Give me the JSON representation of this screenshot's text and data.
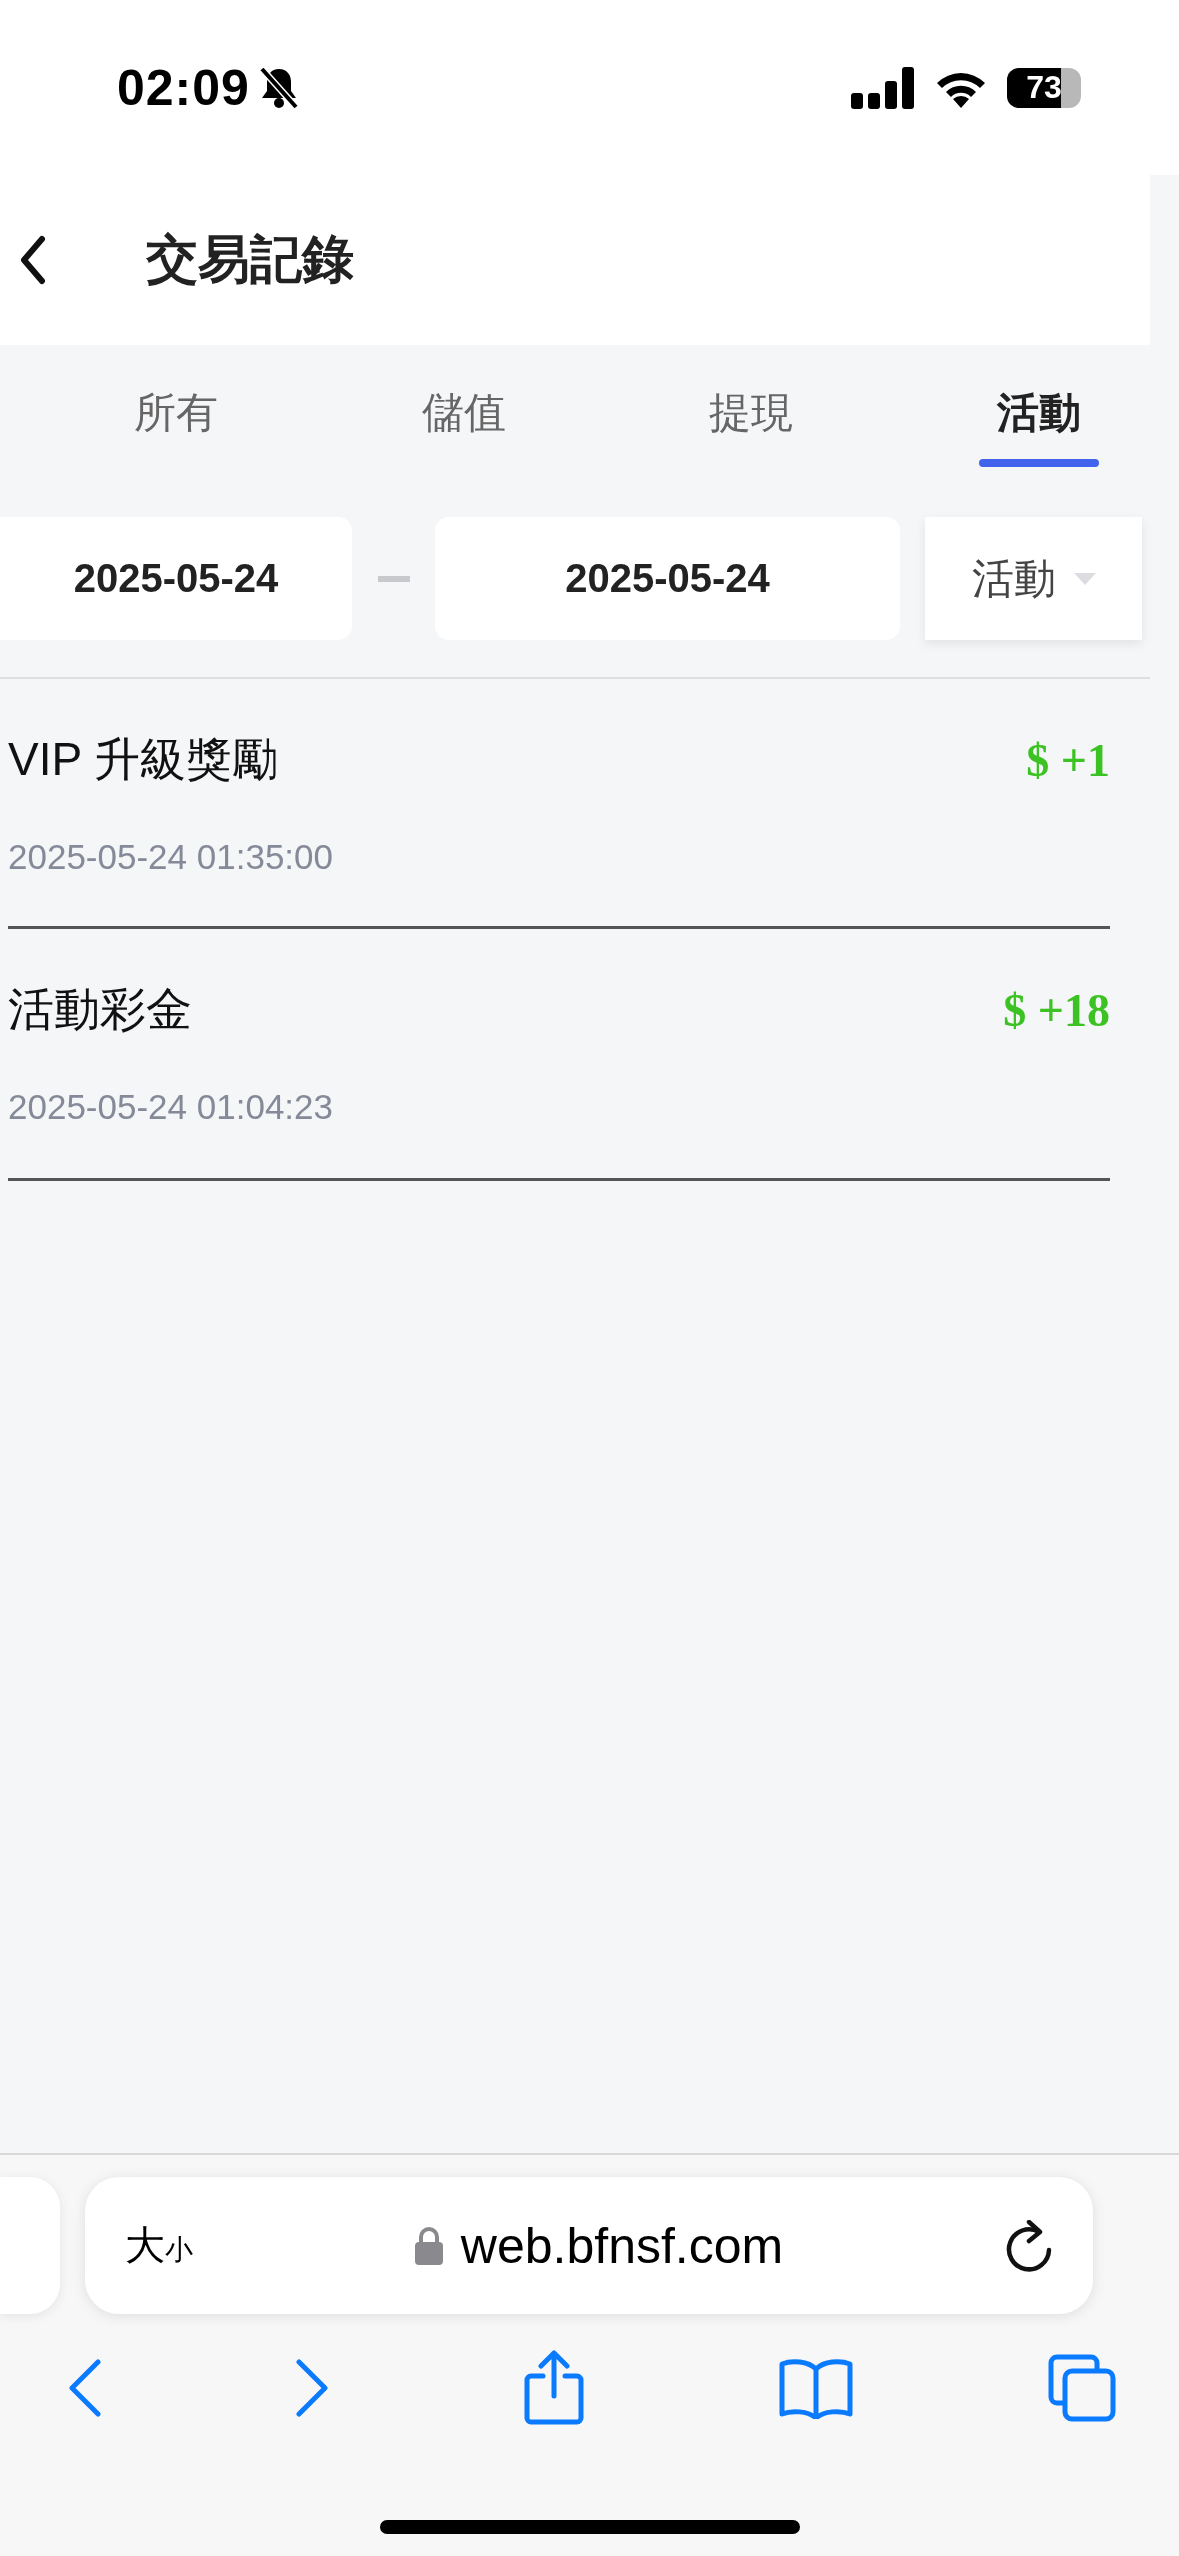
{
  "status_bar": {
    "time": "02:09",
    "battery": "73"
  },
  "header": {
    "title": "交易記錄"
  },
  "tabs": [
    {
      "label": "所有",
      "selected": false
    },
    {
      "label": "儲值",
      "selected": false
    },
    {
      "label": "提現",
      "selected": false
    },
    {
      "label": "活動",
      "selected": true
    }
  ],
  "filter": {
    "start_date": "2025-05-24",
    "end_date": "2025-05-24",
    "category": "活動"
  },
  "records": [
    {
      "title": "VIP 升級獎勵",
      "time": "2025-05-24 01:35:00",
      "amount": "$ +1"
    },
    {
      "title": "活動彩金",
      "time": "2025-05-24 01:04:23",
      "amount": "$ +18"
    }
  ],
  "browser": {
    "text_size": {
      "large": "大",
      "small": "小"
    },
    "url": "web.bfnsf.com"
  }
}
